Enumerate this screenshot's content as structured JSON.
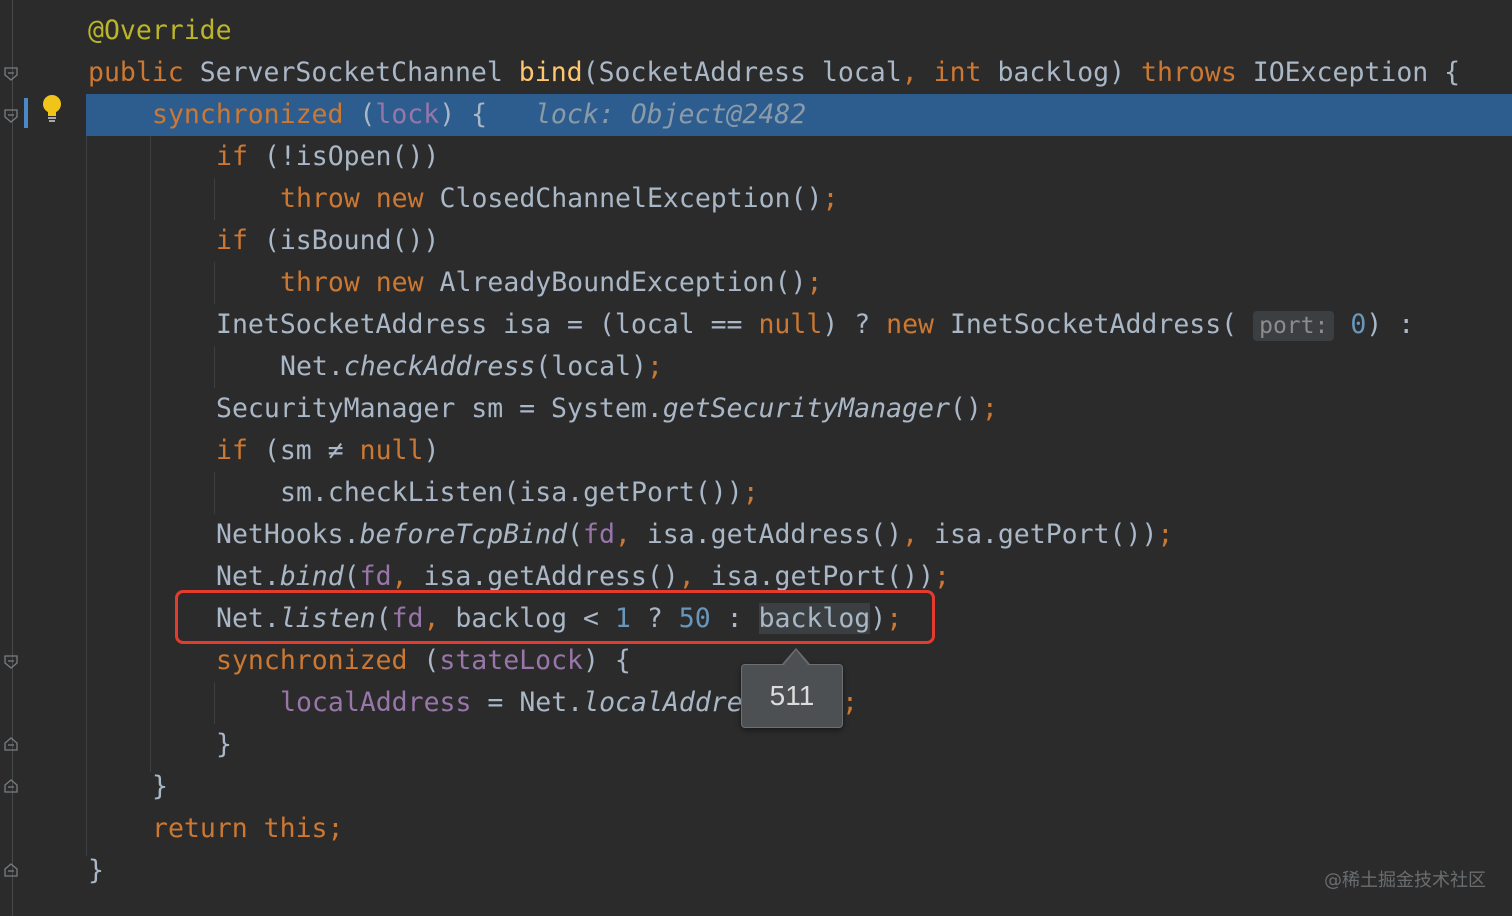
{
  "editor": {
    "lines": [
      {
        "t0": "@Override"
      },
      {
        "t0": "public ",
        "t1": "ServerSocketChannel ",
        "t2": "bind",
        "t3": "(SocketAddress local",
        "t4": ", ",
        "t5": "int ",
        "t6": "backlog) ",
        "t7": "throws ",
        "t8": "IOException {"
      },
      {
        "t0": "synchronized ",
        "t1": "(",
        "t2": "lock",
        "t3": ") {",
        "t4": "lock: Object@2482"
      },
      {
        "t0": "if ",
        "t1": "(!isOpen())"
      },
      {
        "t0": "throw new ",
        "t1": "ClosedChannelException()",
        "t2": ";"
      },
      {
        "t0": "if ",
        "t1": "(isBound())"
      },
      {
        "t0": "throw new ",
        "t1": "AlreadyBoundException()",
        "t2": ";"
      },
      {
        "t0": "InetSocketAddress isa = (local ",
        "t1": "==",
        "t2": " null",
        "t3": ") ? ",
        "t4": "new ",
        "t5": "InetSocketAddress(",
        "t6": "port:",
        "t7": "0",
        "t8": ") :"
      },
      {
        "t0": "Net.",
        "t1": "checkAddress",
        "t2": "(local)",
        "t3": ";"
      },
      {
        "t0": "SecurityManager sm = System.",
        "t1": "getSecurityManager",
        "t2": "()",
        "t3": ";"
      },
      {
        "t0": "if ",
        "t1": "(sm ",
        "t2": "≠",
        "t3": " null",
        "t4": ")"
      },
      {
        "t0": "sm.checkListen(isa.getPort())",
        "t1": ";"
      },
      {
        "t0": "NetHooks.",
        "t1": "beforeTcpBind",
        "t2": "(",
        "t3": "fd",
        "t4": ", ",
        "t5": "isa.getAddress()",
        "t6": ", ",
        "t7": "isa.getPort())",
        "t8": ";"
      },
      {
        "t0": "Net.",
        "t1": "bind",
        "t2": "(",
        "t3": "fd",
        "t4": ", ",
        "t5": "isa.getAddress()",
        "t6": ", ",
        "t7": "isa.getPort())",
        "t8": ";"
      },
      {
        "t0": "Net.",
        "t1": "listen",
        "t2": "(",
        "t3": "fd",
        "t4": ", ",
        "t5": "backlog < ",
        "t6": "1",
        "t7": " ? ",
        "t8": "50",
        "t9": " : ",
        "t10": "backlog",
        "t11": ")",
        "t12": ";"
      },
      {
        "t0": "synchronized ",
        "t1": "(",
        "t2": "stateLock",
        "t3": ") {"
      },
      {
        "t0": "localAddress",
        "t1": " = Net.",
        "t2": "localAddre",
        "t3": ";"
      },
      {
        "t0": "}"
      },
      {
        "t0": "}"
      },
      {
        "t0": "return this;"
      },
      {
        "t0": "}"
      }
    ],
    "tooltip_value": "511",
    "watermark": "@稀土掘金技术社区"
  },
  "colors": {
    "background": "#2b2b2b",
    "keyword": "#cc7832",
    "annotation": "#bbb529",
    "method": "#ffc66d",
    "number": "#6897bb",
    "field": "#9876aa",
    "execution_line": "#2d5d8e",
    "highlight_box": "#e53b2f"
  },
  "icons": {
    "gutter_bulb": "lightbulb-icon",
    "fold_markers": "fold-icon"
  }
}
